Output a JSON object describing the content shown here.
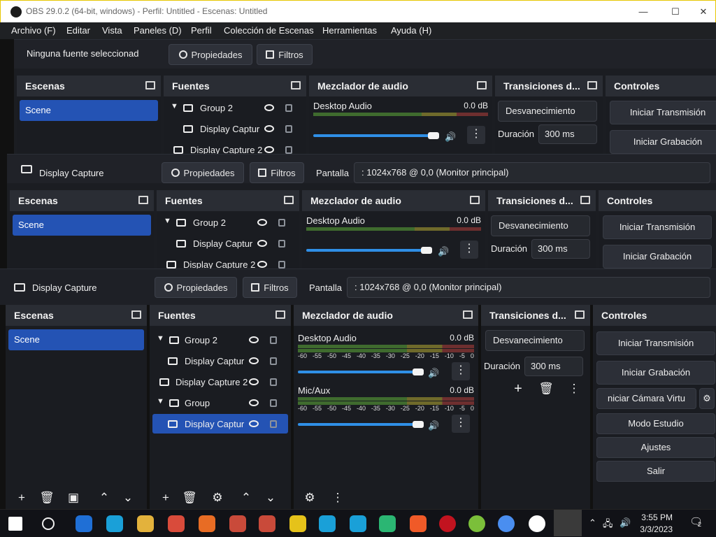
{
  "window": {
    "title": "OBS 29.0.2 (64-bit, windows) - Perfil: Untitled - Escenas: Untitled",
    "minimize": "—",
    "maximize": "☐",
    "close": "✕"
  },
  "menu": [
    "Archivo (F)",
    "Editar",
    "Vista",
    "Paneles (D)",
    "Perfil",
    "Colección de Escenas",
    "Herramientas",
    "Ayuda (H)"
  ],
  "ghost1": {
    "source": "Ninguna fuente seleccionada",
    "props": "Propiedades",
    "filters": "Filtros",
    "scenes_title": "Escenas",
    "scene": "Scene",
    "sources_title": "Fuentes",
    "group2": "Group 2",
    "dc": "Display Captur",
    "dc2": "Display Capture 2",
    "mixer_title": "Mezclador de audio",
    "desktop": "Desktop Audio",
    "db": "0.0 dB",
    "trans_title": "Transiciones d...",
    "trans_value": "Desvanecimiento",
    "dur_label": "Duración",
    "dur_value": "300 ms",
    "ctrl_title": "Controles",
    "start_stream": "Iniciar Transmisión",
    "start_rec": "Iniciar Grabación"
  },
  "ghost2": {
    "source": "Display Capture",
    "props": "Propiedades",
    "filters": "Filtros",
    "pantalla": "Pantalla",
    "pantalla_value": ": 1024x768 @ 0,0 (Monitor principal)"
  },
  "main": {
    "source": "Display Capture",
    "props": "Propiedades",
    "filters": "Filtros",
    "pantalla": "Pantalla",
    "pantalla_value": ": 1024x768 @ 0,0 (Monitor principal)",
    "scenes_title": "Escenas",
    "scene": "Scene",
    "sources_title": "Fuentes",
    "sources": [
      {
        "label": "Group 2",
        "type": "group"
      },
      {
        "label": "Display Captur",
        "type": "child"
      },
      {
        "label": "Display Capture 2",
        "type": "item"
      },
      {
        "label": "Group",
        "type": "group"
      },
      {
        "label": "Display Captur",
        "type": "child",
        "selected": true
      }
    ],
    "mixer_title": "Mezclador de audio",
    "channels": [
      {
        "name": "Desktop Audio",
        "db": "0.0 dB"
      },
      {
        "name": "Mic/Aux",
        "db": "0.0 dB"
      }
    ],
    "ticks": [
      "-60",
      "-55",
      "-50",
      "-45",
      "-40",
      "-35",
      "-30",
      "-25",
      "-20",
      "-15",
      "-10",
      "-5",
      "0"
    ],
    "trans_title": "Transiciones d...",
    "trans_value": "Desvanecimiento",
    "dur_label": "Duración",
    "dur_value": "300 ms",
    "ctrl_title": "Controles",
    "controls": [
      "Iniciar Transmisión",
      "Iniciar Grabación",
      "niciar Cámara Virtu",
      "Modo Estudio",
      "Ajustes",
      "Salir"
    ]
  },
  "taskbar": {
    "time": "3:55 PM",
    "date": "3/3/2023",
    "notif_count": "2"
  },
  "colors": {
    "accent": "#2453b4",
    "panel": "#1a1c21",
    "dock_header": "#2a2d34",
    "meter_green": "#3f6b2e",
    "meter_yellow": "#6f6a2b",
    "meter_red": "#6e2f2f",
    "volume": "#2f8fe6"
  }
}
